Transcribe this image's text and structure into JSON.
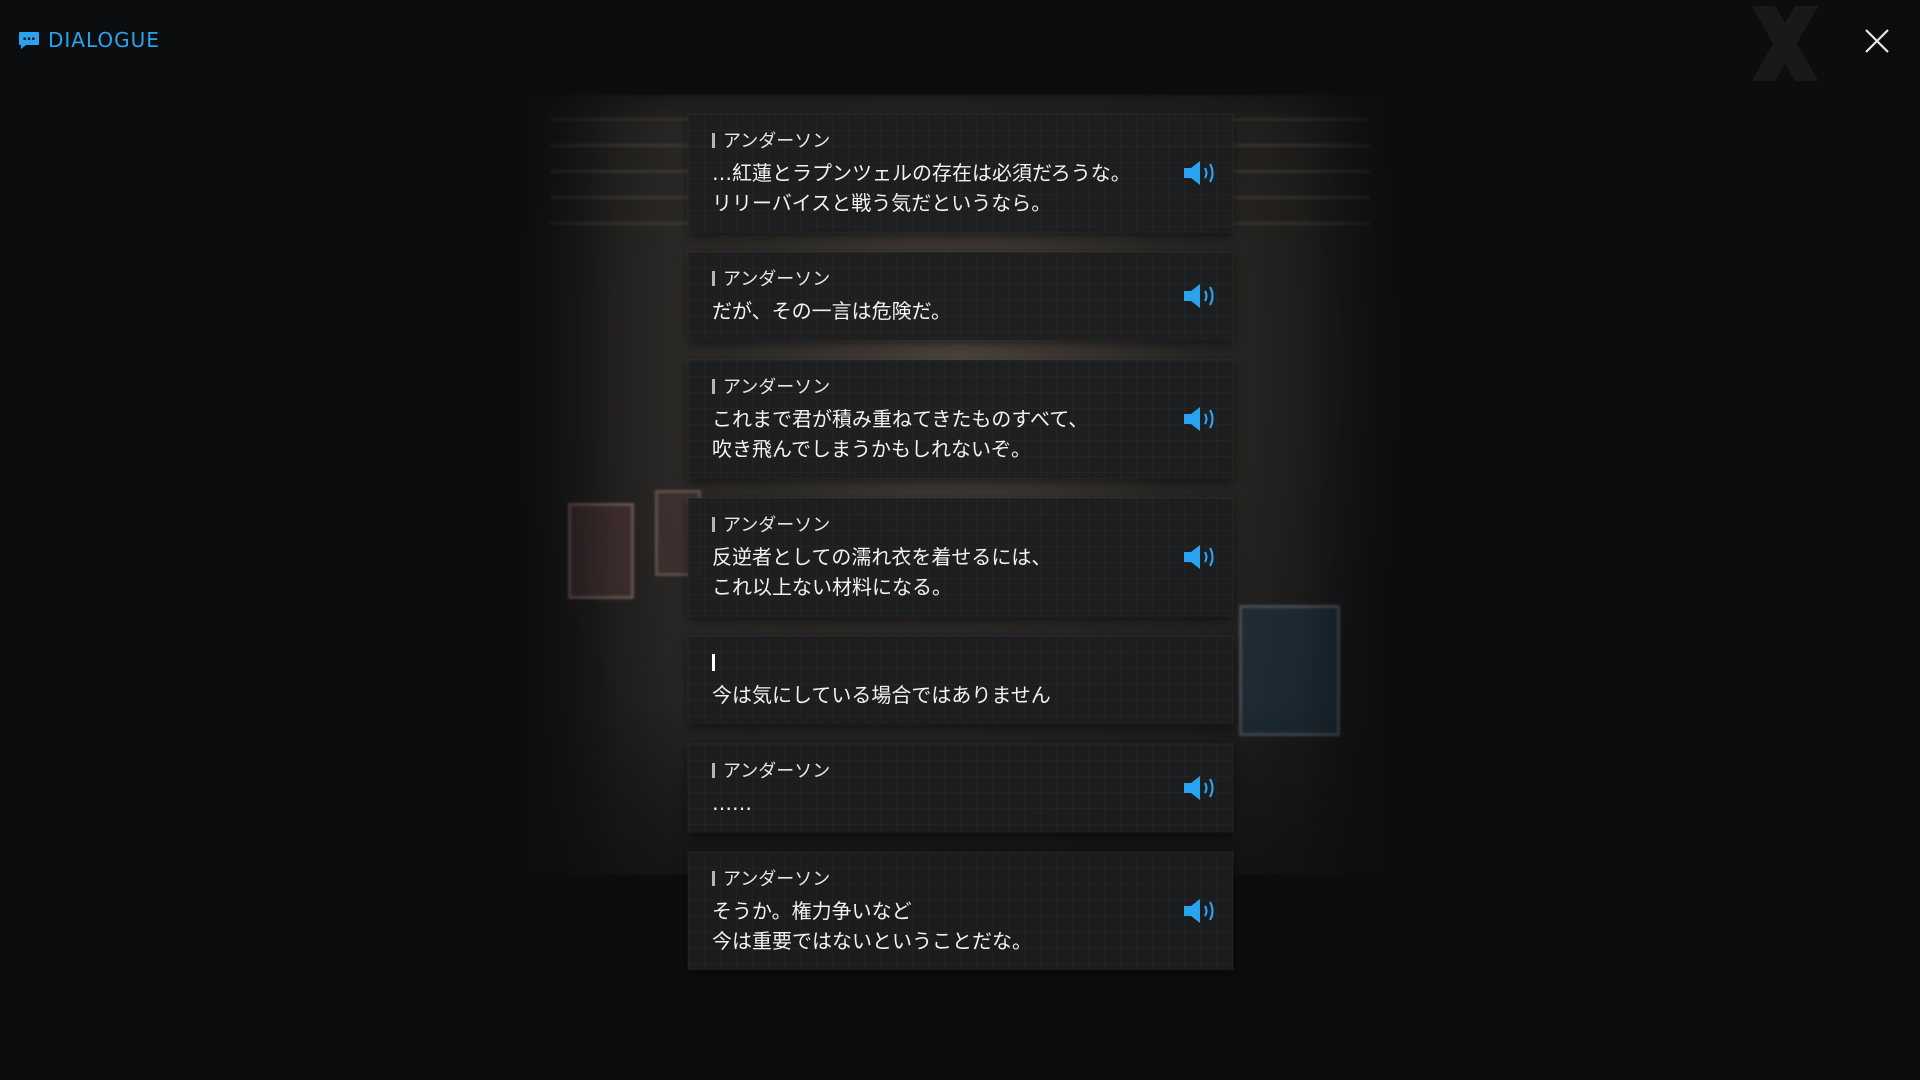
{
  "header": {
    "title": "DIALOGUE",
    "icon": "chat-icon",
    "close_icon": "close-icon"
  },
  "colors": {
    "accent": "#29a3ef",
    "card_bg": "#1c1d20",
    "text": "#f2f2f2"
  },
  "dialogue": [
    {
      "speaker": "アンダーソン",
      "text": "…紅蓮とラプンツェルの存在は必須だろうな。\nリリーバイスと戦う気だというなら。",
      "voice": true
    },
    {
      "speaker": "アンダーソン",
      "text": "だが、その一言は危険だ。",
      "voice": true
    },
    {
      "speaker": "アンダーソン",
      "text": "これまで君が積み重ねてきたものすべて、\n吹き飛んでしまうかもしれないぞ。",
      "voice": true
    },
    {
      "speaker": "アンダーソン",
      "text": "反逆者としての濡れ衣を着せるには、\nこれ以上ない材料になる。",
      "voice": true
    },
    {
      "speaker": "",
      "text": "今は気にしている場合ではありません",
      "voice": false
    },
    {
      "speaker": "アンダーソン",
      "text": "……",
      "voice": true
    },
    {
      "speaker": "アンダーソン",
      "text": "そうか。権力争いなど\n今は重要ではないということだな。",
      "voice": true
    }
  ]
}
